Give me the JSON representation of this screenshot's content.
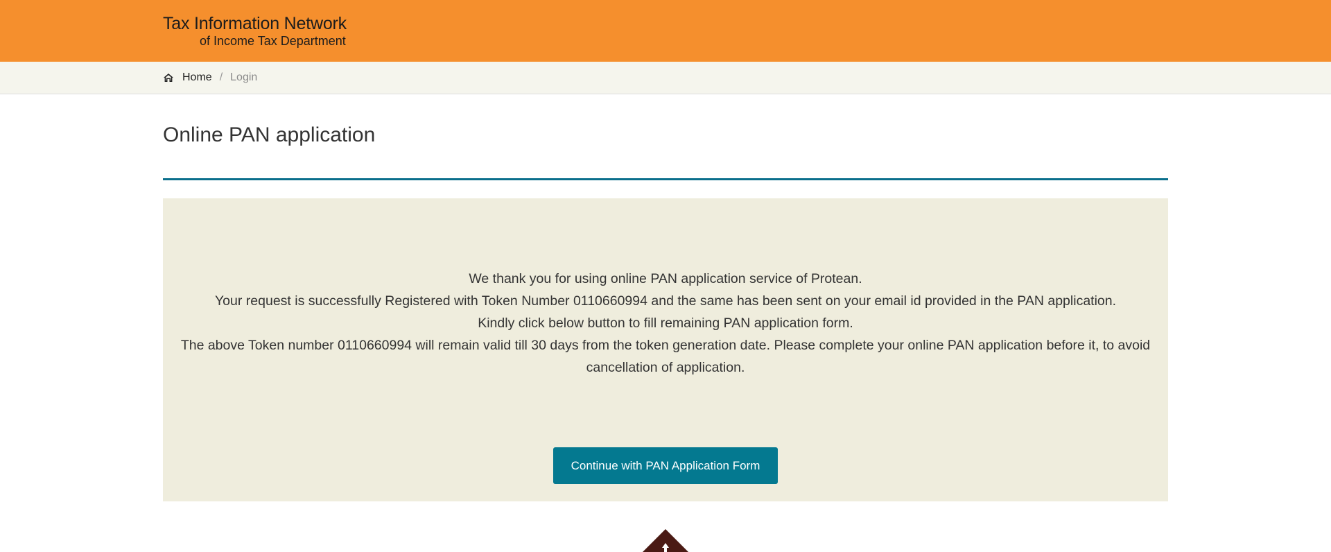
{
  "header": {
    "logo_line1": "Tax Information Network",
    "logo_line2": "of Income Tax Department",
    "background_color": "#f58f2d"
  },
  "breadcrumb": {
    "icon": "home-icon",
    "home_label": "Home",
    "separator": "/",
    "current_label": "Login"
  },
  "main": {
    "title": "Online PAN application",
    "accent_color": "#0a6f8c",
    "panel_color": "#efeddd",
    "message_lines": [
      "We thank you for using online PAN application service of Protean.",
      "Your request is successfully Registered with Token Number 0110660994 and the same has been sent on your email id provided in the PAN application.",
      "Kindly click below button to fill remaining PAN application form.",
      "The above Token number 0110660994 will remain valid till 30 days from the token generation date. Please complete your online PAN application before it, to avoid cancellation of application."
    ],
    "continue_button_label": "Continue with PAN Application Form",
    "button_color": "#047990"
  },
  "scroll_top": {
    "icon": "arrow-up-icon",
    "color": "#4a1a14"
  }
}
